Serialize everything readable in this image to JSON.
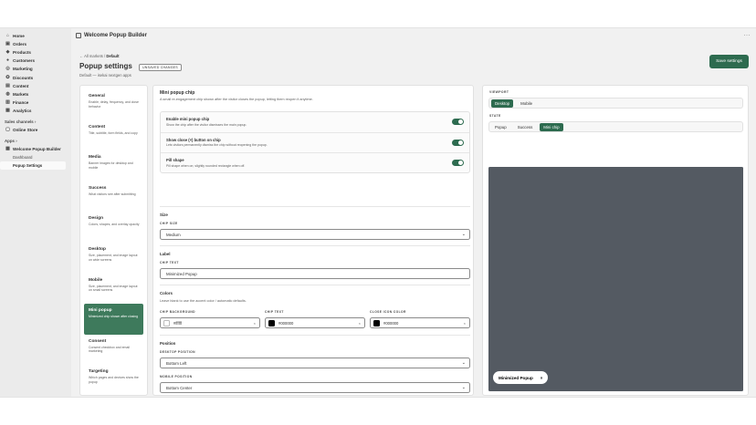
{
  "sidebar": {
    "items": [
      {
        "label": "Home",
        "icon": "home-icon"
      },
      {
        "label": "Orders",
        "icon": "orders-icon"
      },
      {
        "label": "Products",
        "icon": "tag-icon"
      },
      {
        "label": "Customers",
        "icon": "person-icon"
      },
      {
        "label": "Marketing",
        "icon": "target-icon"
      },
      {
        "label": "Discounts",
        "icon": "discount-icon"
      },
      {
        "label": "Content",
        "icon": "content-icon"
      },
      {
        "label": "Markets",
        "icon": "globe-icon"
      },
      {
        "label": "Finance",
        "icon": "bank-icon"
      },
      {
        "label": "Analytics",
        "icon": "chart-icon"
      }
    ],
    "sales_channels_label": "Sales channels",
    "online_store": "Online Store",
    "apps_label": "Apps",
    "app_name": "Welcome Popup Builder",
    "app_subitems": [
      "Dashboard",
      "Popup Settings"
    ]
  },
  "header": {
    "app_title": "Welcome Popup Builder",
    "more": "···"
  },
  "page": {
    "breadcrumb_back": "← All markets",
    "breadcrumb_sep": "/",
    "breadcrumb_current": "Default",
    "title": "Popup settings",
    "badge": "UNSAVED CHANGES",
    "subtitle": "Default — isekai nextgen apps",
    "save_label": "Save settings"
  },
  "tabs": [
    {
      "title": "General",
      "desc": "Enable, delay, frequency, and close behavior"
    },
    {
      "title": "Content",
      "desc": "Title, subtitle, form fields, and copy"
    },
    {
      "title": "Media",
      "desc": "Banner images for desktop and mobile"
    },
    {
      "title": "Success",
      "desc": "What visitors see after submitting"
    },
    {
      "title": "Design",
      "desc": "Colors, shapes, and overlay opacity"
    },
    {
      "title": "Desktop",
      "desc": "Size, placement, and image layout on wide screens"
    },
    {
      "title": "Mobile",
      "desc": "Size, placement, and image layout on small screens"
    },
    {
      "title": "Mini popup",
      "desc": "Minimized chip shown after closing"
    },
    {
      "title": "Consent",
      "desc": "Consent checkbox and email marketing"
    },
    {
      "title": "Targeting",
      "desc": "Which pages and devices show the popup"
    }
  ],
  "active_tab_index": 7,
  "mini": {
    "title": "Mini popup chip",
    "desc": "A small re-engagement chip shown after the visitor closes the popup, letting them reopen it anytime.",
    "toggles": [
      {
        "title": "Enable mini popup chip",
        "desc": "Show the chip after the visitor dismisses the main popup.",
        "on": true
      },
      {
        "title": "Show close (×) button on chip",
        "desc": "Lets visitors permanently dismiss the chip without reopening the popup.",
        "on": true
      },
      {
        "title": "Pill shape",
        "desc": "Pill shape when on; slightly rounded rectangle when off.",
        "on": true
      }
    ],
    "size_title": "Size",
    "chip_size_label": "CHIP SIZE",
    "chip_size_value": "Medium",
    "label_title": "Label",
    "chip_text_label": "CHIP TEXT",
    "chip_text_value": "Minimized Popup",
    "colors_title": "Colors",
    "colors_help": "Leave blank to use the accent color / automatic defaults.",
    "colors": [
      {
        "label": "CHIP BACKGROUND",
        "value": "#ffffff",
        "swatch": "#ffffff"
      },
      {
        "label": "CHIP TEXT",
        "value": "#000000",
        "swatch": "#000000"
      },
      {
        "label": "CLOSE ICON COLOR",
        "value": "#000000",
        "swatch": "#000000"
      }
    ],
    "clear_glyph": "×",
    "position_title": "Position",
    "desktop_position_label": "DESKTOP POSITION",
    "desktop_position_value": "Bottom Left",
    "mobile_position_label": "MOBILE POSITION",
    "mobile_position_value": "Bottom Center"
  },
  "preview": {
    "viewport_label": "VIEWPORT",
    "viewport_options": [
      "Desktop",
      "Mobile"
    ],
    "viewport_active": 0,
    "state_label": "STATE",
    "state_options": [
      "Popup",
      "Success",
      "Mini chip"
    ],
    "state_active": 2,
    "chip_text": "Minimized Popup",
    "chip_close": "×",
    "stage_color": "#545a62"
  },
  "colors": {
    "accent": "#2d6b4f",
    "active_tab": "#3e7a5c"
  }
}
